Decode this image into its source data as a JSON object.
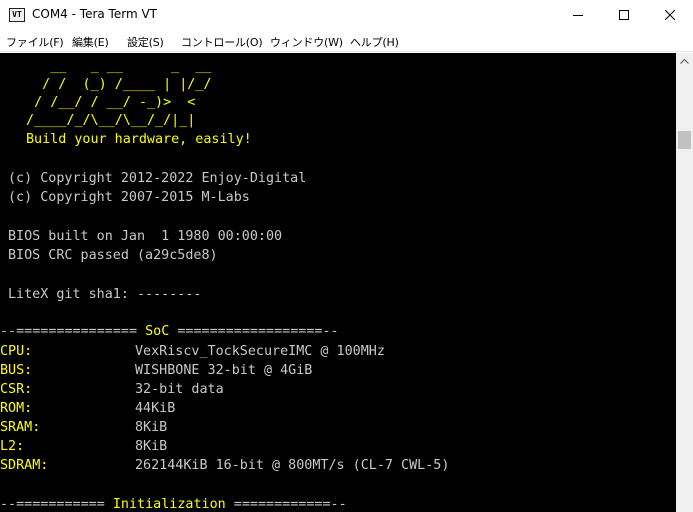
{
  "window": {
    "title": "COM4 - Tera Term VT",
    "icon_text": "VT",
    "controls": [
      "minimize-icon",
      "maximize-icon",
      "close-icon"
    ]
  },
  "menu": [
    "ファイル(F)",
    "編集(E)",
    "設定(S)",
    "コントロール(O)",
    "ウィンドウ(W)",
    "ヘルプ(H)"
  ],
  "terminal": {
    "logo_lines": [
      "    __   _ __      _  __",
      "   / /  (_) /____ | |/_/",
      "  / /__/ / __/ -_)>  <",
      " /____/_/\\__/\\__/_/|_|"
    ],
    "tagline": "Build your hardware, easily!",
    "copyright": [
      "(c) Copyright 2012-2022 Enjoy-Digital",
      "(c) Copyright 2007-2015 M-Labs"
    ],
    "bios": [
      "BIOS built on Jan  1 1980 00:00:00",
      "BIOS CRC passed (a29c5de8)"
    ],
    "git": "LiteX git sha1: --------",
    "soc_header": {
      "left": "--=============== ",
      "name": "SoC",
      "right": " ==================--"
    },
    "soc_rows": [
      {
        "label": "CPU:",
        "value": "VexRiscv_TockSecureIMC @ 100MHz"
      },
      {
        "label": "BUS:",
        "value": "WISHBONE 32-bit @ 4GiB"
      },
      {
        "label": "CSR:",
        "value": "32-bit data"
      },
      {
        "label": "ROM:",
        "value": "44KiB"
      },
      {
        "label": "SRAM:",
        "value": "8KiB"
      },
      {
        "label": "L2:",
        "value": "8KiB"
      },
      {
        "label": "SDRAM:",
        "value": "262144KiB 16-bit @ 800MT/s (CL-7 CWL-5)"
      }
    ],
    "init_header": {
      "left": "--=========== ",
      "name": "Initialization",
      "right": " ============--"
    }
  },
  "colors": {
    "terminal_bg": "#000000",
    "terminal_text": "#c8c8c8",
    "highlight": "#ffff00"
  }
}
